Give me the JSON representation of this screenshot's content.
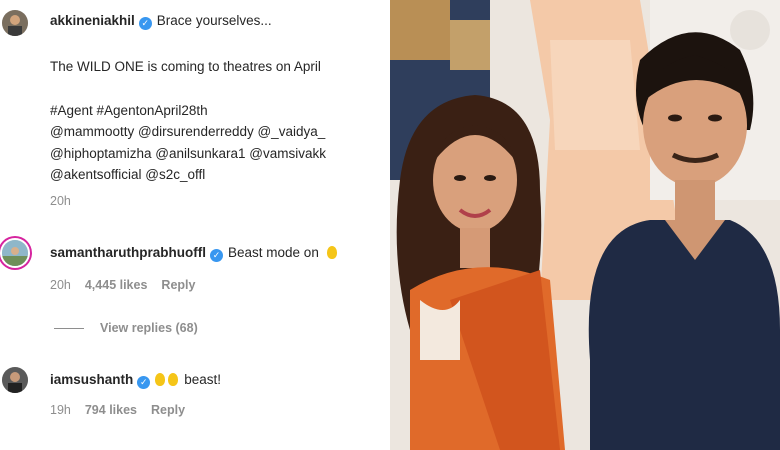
{
  "post": {
    "username": "akkineniakhil",
    "caption_line1": "Brace yourselves...",
    "caption_line2": "The WILD ONE is coming to theatres on April",
    "caption_line3": "#Agent #AgentonApril28th",
    "caption_line4": "@mammootty @dirsurenderreddy @_vaidya_",
    "caption_line5": "@hiphoptamizha @anilsunkara1 @vamsivakk",
    "caption_line6": "@akentsofficial @s2c_offl",
    "time": "20h"
  },
  "comments": [
    {
      "username": "samantharuthprabhuoffl",
      "text": "Beast mode on",
      "time": "20h",
      "likes": "4,445 likes",
      "reply": "Reply",
      "view_replies": "View replies (68)"
    },
    {
      "username": "iamsushanth",
      "text": "beast!",
      "time": "19h",
      "likes": "794 likes",
      "reply": "Reply"
    }
  ],
  "icons": {
    "verified": "verified-badge-icon",
    "emoji": "clapping-hands-icon"
  },
  "colors": {
    "verified_blue": "#3897f0",
    "meta_gray": "#8e8e8e",
    "text": "#262626"
  }
}
